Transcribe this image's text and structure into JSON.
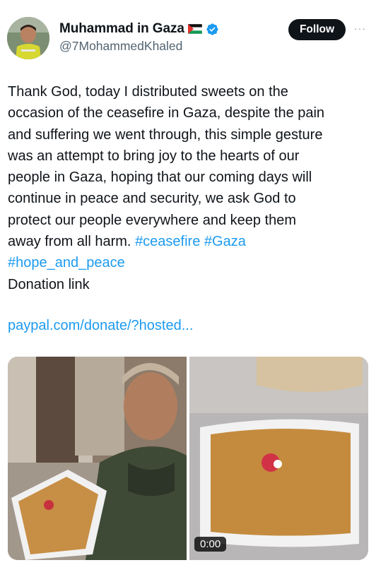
{
  "user": {
    "display_name": "Muhammad in Gaza",
    "handle": "@7MohammedKhaled",
    "follow_label": "Follow",
    "more_label": "···",
    "verified_color": "#1d9bf0"
  },
  "tweet": {
    "lines": [
      "Thank God, today I distributed sweets on the",
      "occasion of the ceasefire in Gaza, despite the pain",
      "and suffering we went through, this simple gesture",
      "was an attempt to bring joy to the hearts of our",
      "people in Gaza, hoping that our coming days will",
      "continue in peace and security, we ask God to",
      "protect our people everywhere and keep them"
    ],
    "last_line_text": "away from all harm. ",
    "hashtags": [
      "#ceasefire",
      "#Gaza",
      "#hope_and_peace"
    ],
    "donation_text": "Donation link",
    "link_text": "paypal.com/donate/?hosted..."
  },
  "media": {
    "video_duration": "0:00"
  },
  "icons": {
    "flag": "palestine-flag-icon",
    "verified": "verified-badge-icon",
    "more": "more-options-icon"
  }
}
